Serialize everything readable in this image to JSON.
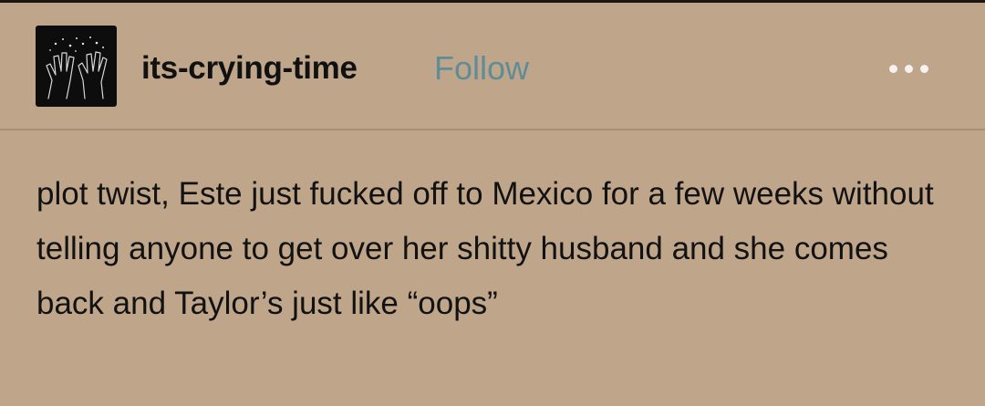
{
  "post": {
    "author": {
      "username": "its-crying-time",
      "avatar_icon": "hands-sparkles-icon"
    },
    "follow_label": "Follow",
    "more_icon": "ellipsis-icon",
    "body": "plot twist, Este just fucked off to Mexico for a few weeks without telling anyone to get over her shitty husband and she comes back and Taylor’s just like “oops”"
  },
  "colors": {
    "background": "#bfa68a",
    "follow": "#5f8c96",
    "text": "#121212"
  }
}
